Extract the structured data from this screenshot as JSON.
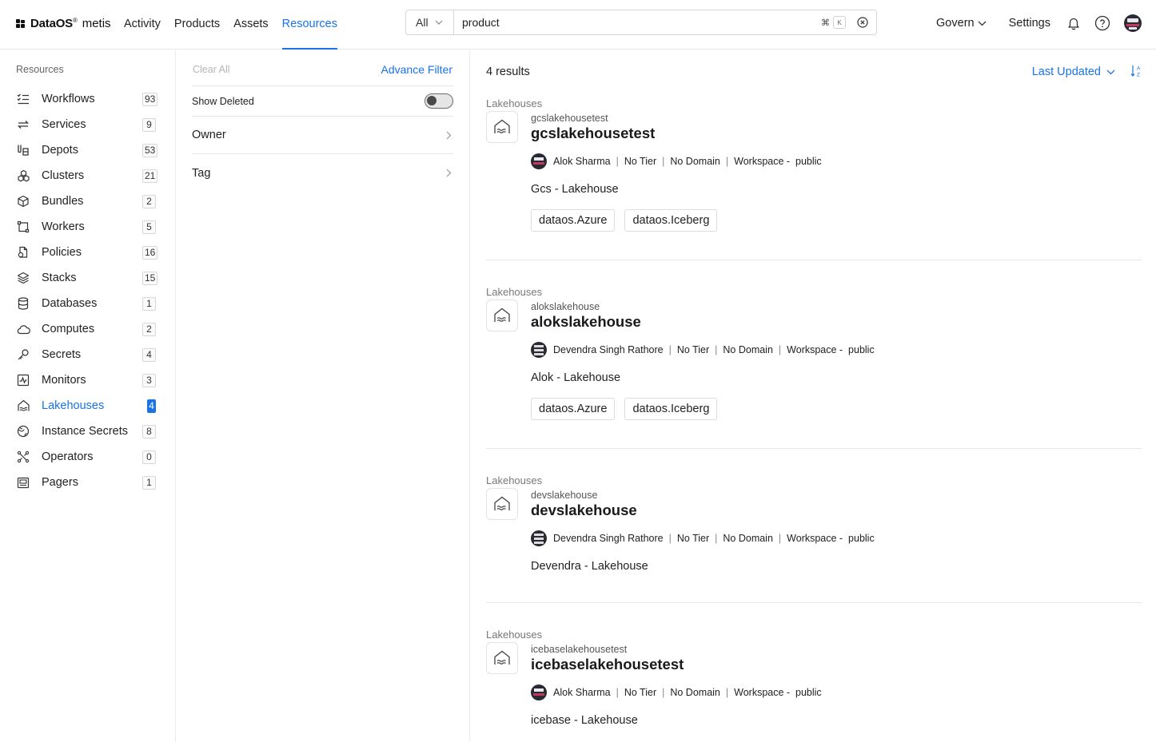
{
  "header": {
    "brand": "DataOS",
    "brand_mark": "®",
    "product": "metis",
    "nav": [
      "Activity",
      "Products",
      "Assets",
      "Resources"
    ],
    "active_nav": "Resources",
    "search_scope": "All",
    "search_value": "product",
    "search_shortcut": "⌘",
    "search_shortcut_key": "K",
    "govern_label": "Govern",
    "settings_label": "Settings"
  },
  "sidebar": {
    "title": "Resources",
    "items": [
      {
        "label": "Workflows",
        "count": "93",
        "icon": "workflows-icon"
      },
      {
        "label": "Services",
        "count": "9",
        "icon": "services-icon"
      },
      {
        "label": "Depots",
        "count": "53",
        "icon": "depots-icon"
      },
      {
        "label": "Clusters",
        "count": "21",
        "icon": "clusters-icon"
      },
      {
        "label": "Bundles",
        "count": "2",
        "icon": "bundles-icon"
      },
      {
        "label": "Workers",
        "count": "5",
        "icon": "workers-icon"
      },
      {
        "label": "Policies",
        "count": "16",
        "icon": "policies-icon"
      },
      {
        "label": "Stacks",
        "count": "15",
        "icon": "stacks-icon"
      },
      {
        "label": "Databases",
        "count": "1",
        "icon": "databases-icon"
      },
      {
        "label": "Computes",
        "count": "2",
        "icon": "computes-icon"
      },
      {
        "label": "Secrets",
        "count": "4",
        "icon": "secrets-icon"
      },
      {
        "label": "Monitors",
        "count": "3",
        "icon": "monitors-icon"
      },
      {
        "label": "Lakehouses",
        "count": "4",
        "icon": "lakehouses-icon"
      },
      {
        "label": "Instance Secrets",
        "count": "8",
        "icon": "instance-secrets-icon"
      },
      {
        "label": "Operators",
        "count": "0",
        "icon": "operators-icon"
      },
      {
        "label": "Pagers",
        "count": "1",
        "icon": "pagers-icon"
      }
    ],
    "active_item": "Lakehouses"
  },
  "filters": {
    "clear_all": "Clear All",
    "advance_filter": "Advance Filter",
    "show_deleted": "Show Deleted",
    "show_deleted_on": false,
    "owner": "Owner",
    "tag": "Tag"
  },
  "results": {
    "count_label": "4 results",
    "sort_label": "Last Updated",
    "items": [
      {
        "category": "Lakehouses",
        "subname": "gcslakehousetest",
        "name": "gcslakehousetest",
        "owner": "Alok Sharma",
        "tier": "No Tier",
        "domain": "No Domain",
        "workspace": "Workspace -  public",
        "description": "Gcs - Lakehouse",
        "tags": [
          "dataos.Azure",
          "dataos.Iceberg"
        ]
      },
      {
        "category": "Lakehouses",
        "subname": "alokslakehouse",
        "name": "alokslakehouse",
        "owner": "Devendra Singh Rathore",
        "tier": "No Tier",
        "domain": "No Domain",
        "workspace": "Workspace -  public",
        "description": "Alok - Lakehouse",
        "tags": [
          "dataos.Azure",
          "dataos.Iceberg"
        ]
      },
      {
        "category": "Lakehouses",
        "subname": "devslakehouse",
        "name": "devslakehouse",
        "owner": "Devendra Singh Rathore",
        "tier": "No Tier",
        "domain": "No Domain",
        "workspace": "Workspace -  public",
        "description": "Devendra - Lakehouse",
        "tags": []
      },
      {
        "category": "Lakehouses",
        "subname": "icebaselakehousetest",
        "name": "icebaselakehousetest",
        "owner": "Alok Sharma",
        "tier": "No Tier",
        "domain": "No Domain",
        "workspace": "Workspace -  public",
        "description": "icebase - Lakehouse",
        "tags": []
      }
    ]
  },
  "colors": {
    "accent": "#1a73e8",
    "text": "#1f1f1f",
    "border": "#e6e6e6"
  }
}
